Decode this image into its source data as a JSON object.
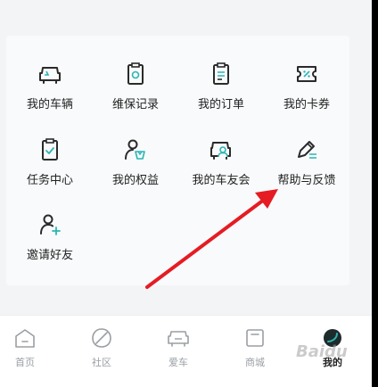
{
  "menu": {
    "items": [
      {
        "label": "我的车辆",
        "icon": "car-icon"
      },
      {
        "label": "维保记录",
        "icon": "maintenance-icon"
      },
      {
        "label": "我的订单",
        "icon": "order-icon"
      },
      {
        "label": "我的卡券",
        "icon": "coupon-icon"
      },
      {
        "label": "任务中心",
        "icon": "task-icon"
      },
      {
        "label": "我的权益",
        "icon": "benefit-icon"
      },
      {
        "label": "我的车友会",
        "icon": "car-club-icon"
      },
      {
        "label": "帮助与反馈",
        "icon": "feedback-icon"
      },
      {
        "label": "邀请好友",
        "icon": "invite-icon"
      }
    ]
  },
  "tabbar": {
    "items": [
      {
        "label": "首页",
        "icon": "home-icon"
      },
      {
        "label": "社区",
        "icon": "leaf-icon"
      },
      {
        "label": "爱车",
        "icon": "car-icon"
      },
      {
        "label": "商城",
        "icon": "shop-icon"
      },
      {
        "label": "我的",
        "icon": "profile-icon"
      }
    ],
    "active_index": 4
  },
  "colors": {
    "accent": "#2bb5b5",
    "icon_dark": "#2a2a2a",
    "annotation_arrow": "#e51c23"
  }
}
